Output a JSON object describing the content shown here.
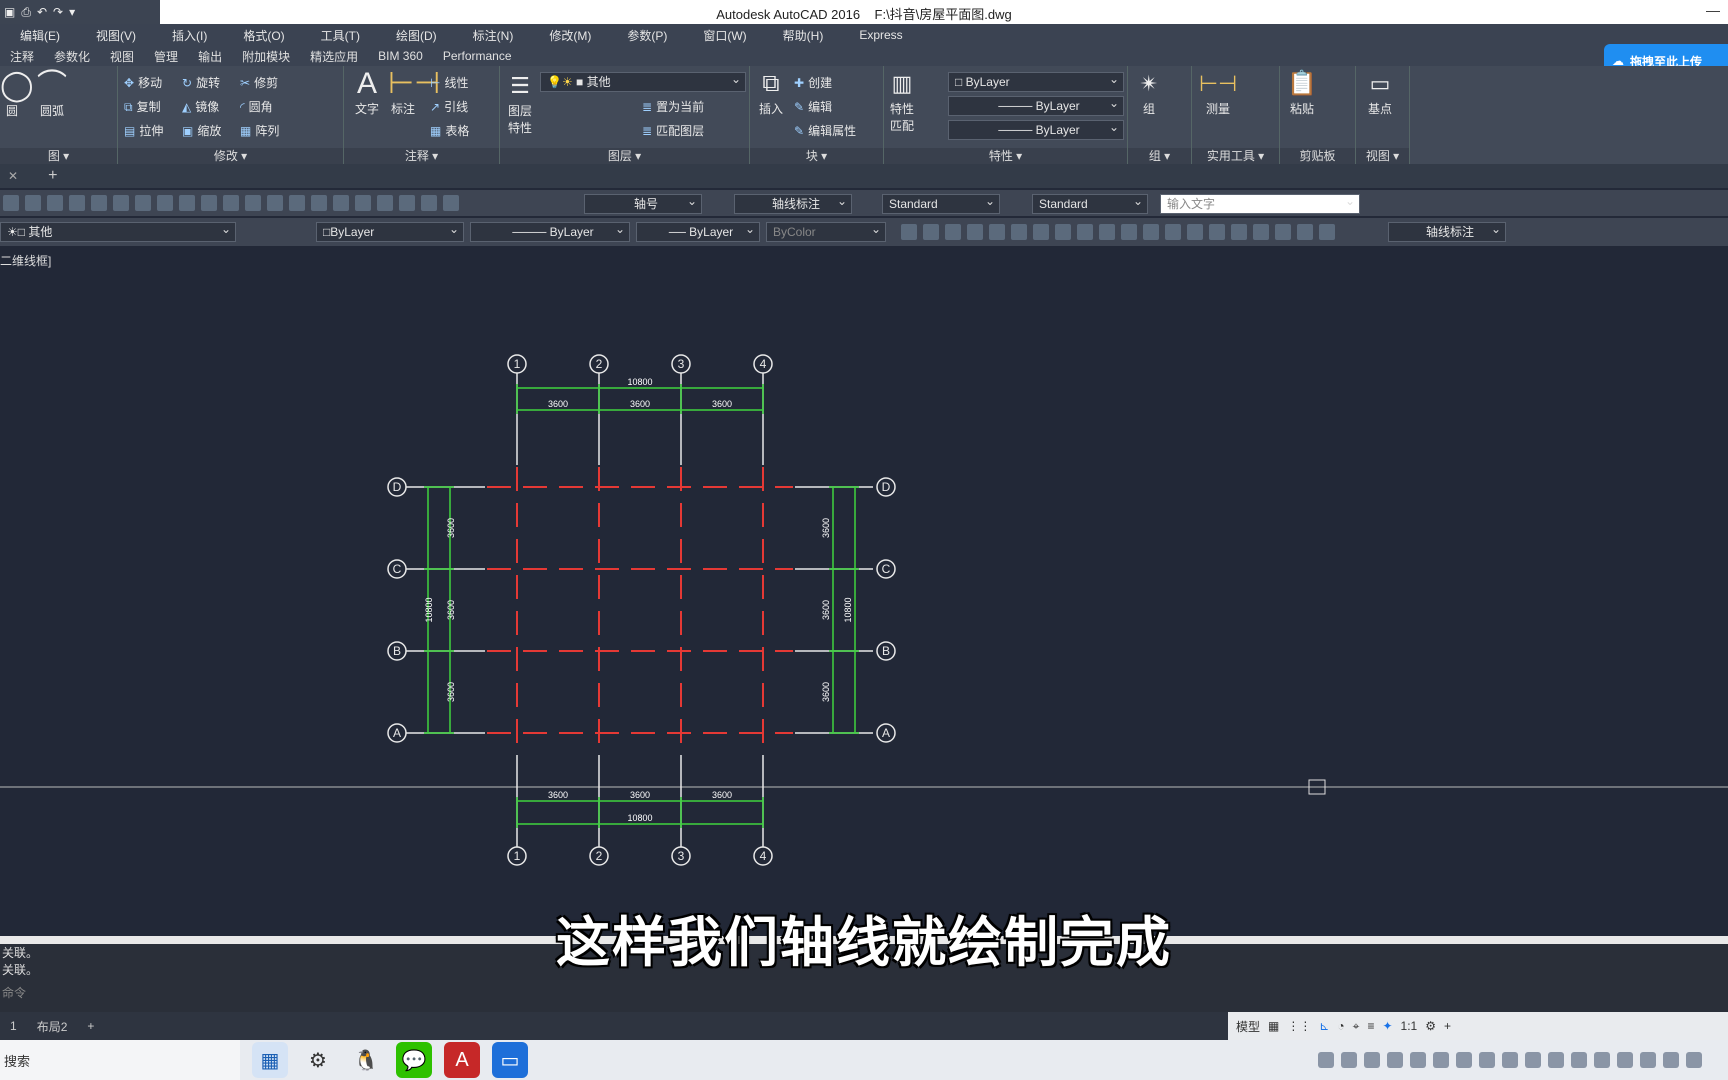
{
  "title": {
    "app": "Autodesk AutoCAD 2016",
    "file": "F:\\抖音\\房屋平面图.dwg"
  },
  "menu": [
    "编辑(E)",
    "视图(V)",
    "插入(I)",
    "格式(O)",
    "工具(T)",
    "绘图(D)",
    "标注(N)",
    "修改(M)",
    "参数(P)",
    "窗口(W)",
    "帮助(H)",
    "Express"
  ],
  "ribbon_tabs": [
    "注释",
    "参数化",
    "视图",
    "管理",
    "输出",
    "附加模块",
    "精选应用",
    "BIM 360",
    "Performance"
  ],
  "upload_label": "拖拽至此上传",
  "ribbon": {
    "draw": {
      "circle": "圆",
      "arc": "圆弧",
      "title": "图 ▾"
    },
    "modify": {
      "move": "移动",
      "rotate": "旋转",
      "trim": "修剪",
      "copy": "复制",
      "mirror": "镜像",
      "fillet": "圆角",
      "stretch": "拉伸",
      "scale": "缩放",
      "array": "阵列",
      "title": "修改 ▾"
    },
    "annotation": {
      "text": "文字",
      "dim": "标注",
      "linear": "线性",
      "leader": "引线",
      "table": "表格",
      "title": "注释 ▾"
    },
    "layers": {
      "props": "图层\n特性",
      "current": "其他",
      "set_current": "置为当前",
      "match": "匹配图层",
      "title": "图层 ▾"
    },
    "block": {
      "insert": "插入",
      "create": "创建",
      "edit": "编辑",
      "attr": "编辑属性",
      "title": "块 ▾"
    },
    "properties": {
      "match": "特性\n匹配",
      "color": "ByLayer",
      "linetype": "ByLayer",
      "lineweight": "ByLayer",
      "title": "特性 ▾"
    },
    "group": {
      "label": "组",
      "title": "组 ▾"
    },
    "utilities": {
      "measure": "测量",
      "title": "实用工具 ▾"
    },
    "clipboard": {
      "paste": "粘贴",
      "title": "剪贴板"
    },
    "view": {
      "base": "基点",
      "title": "视图 ▾"
    }
  },
  "toolbar1": {
    "text_style": "轴号",
    "dim_style": "轴线标注",
    "table_style": "Standard",
    "mleader_style": "Standard",
    "search_placeholder": "输入文字"
  },
  "toolbar2": {
    "layer": "其他",
    "color": "ByLayer",
    "linetype": "ByLayer",
    "lineweight": "ByLayer",
    "plotstyle": "ByColor",
    "dimstyle": "轴线标注"
  },
  "viewport_label": "二维线框]",
  "drawing": {
    "axes_numbers": [
      "1",
      "2",
      "3",
      "4"
    ],
    "axes_letters": [
      "D",
      "C",
      "B",
      "A"
    ],
    "spans_x": [
      "3600",
      "3600",
      "3600"
    ],
    "total_x": "10800",
    "spans_y": [
      "3600",
      "3600",
      "3600"
    ],
    "total_y": "10800"
  },
  "command_history": [
    "关联。",
    "关联。"
  ],
  "command_prompt": "命令",
  "caption": "这样我们轴线就绘制完成",
  "layout_tabs": [
    "1",
    "布局2",
    "+"
  ],
  "status": {
    "model": "模型",
    "scale": "1:1"
  },
  "taskbar": {
    "search": "搜索"
  }
}
